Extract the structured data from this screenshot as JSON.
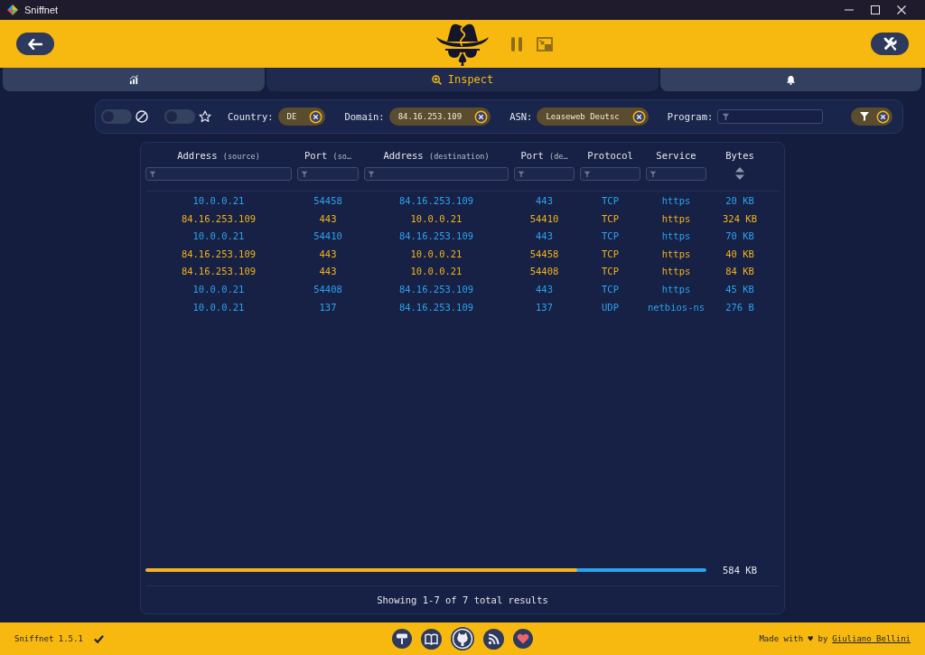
{
  "window": {
    "title": "Sniffnet"
  },
  "tabs": [
    {
      "selected": false
    },
    {
      "label": "Inspect",
      "selected": true
    },
    {
      "selected": false
    }
  ],
  "filters": {
    "toggles": [
      {
        "on": false
      },
      {
        "on": false
      }
    ],
    "fields": [
      {
        "kind": "chip",
        "label": "Country:",
        "value": "DE"
      },
      {
        "kind": "chip",
        "label": "Domain:",
        "value": "84.16.253.109"
      },
      {
        "kind": "chip",
        "label": "ASN:",
        "value": "Leaseweb Deutsc"
      },
      {
        "kind": "input",
        "label": "Program:"
      }
    ]
  },
  "table": {
    "columns": [
      {
        "label": "Address",
        "detail": "(source)",
        "kind": "filter"
      },
      {
        "label": "Port",
        "detail": "(so…",
        "kind": "filter"
      },
      {
        "label": "Address",
        "detail": "(destination)",
        "kind": "filter"
      },
      {
        "label": "Port",
        "detail": "(de…",
        "kind": "filter"
      },
      {
        "label": "Protocol",
        "kind": "filter"
      },
      {
        "label": "Service",
        "kind": "filter"
      },
      {
        "label": "Bytes",
        "kind": "sort"
      }
    ],
    "rows": [
      {
        "cells": [
          "10.0.0.21",
          "54458",
          "84.16.253.109",
          "443",
          "TCP",
          "https",
          "20 KB"
        ],
        "color": "#2ba2ee"
      },
      {
        "cells": [
          "84.16.253.109",
          "443",
          "10.0.0.21",
          "54410",
          "TCP",
          "https",
          "324 KB"
        ],
        "color": "#f3b21c"
      },
      {
        "cells": [
          "10.0.0.21",
          "54410",
          "84.16.253.109",
          "443",
          "TCP",
          "https",
          "70 KB"
        ],
        "color": "#2ba2ee"
      },
      {
        "cells": [
          "84.16.253.109",
          "443",
          "10.0.0.21",
          "54458",
          "TCP",
          "https",
          "40 KB"
        ],
        "color": "#f3b21c"
      },
      {
        "cells": [
          "84.16.253.109",
          "443",
          "10.0.0.21",
          "54408",
          "TCP",
          "https",
          "84 KB"
        ],
        "color": "#f3b21c"
      },
      {
        "cells": [
          "10.0.0.21",
          "54408",
          "84.16.253.109",
          "443",
          "TCP",
          "https",
          "45 KB"
        ],
        "color": "#2ba2ee"
      },
      {
        "cells": [
          "10.0.0.21",
          "137",
          "84.16.253.109",
          "137",
          "UDP",
          "netbios-ns",
          "276 B"
        ],
        "color": "#2ba2ee"
      }
    ],
    "traffic_bar": {
      "level": 0.77
    },
    "total_bytes": "584 KB",
    "summary": "Showing 1-7 of 7 total results"
  },
  "status_bar": {
    "version": "Sniffnet 1.5.1",
    "up_to_date": true,
    "credit": "Made with ♥ by",
    "author": "Giuliano Bellini"
  }
}
